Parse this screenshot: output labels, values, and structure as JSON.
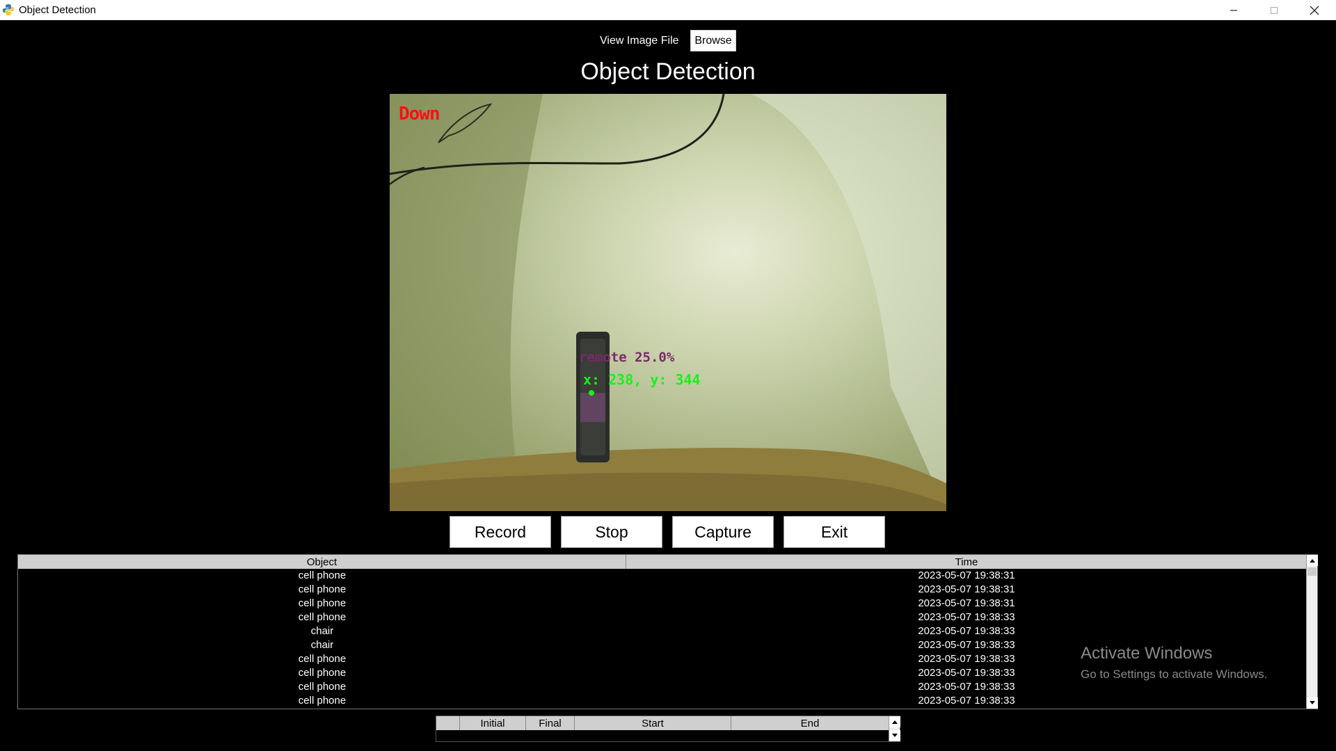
{
  "window": {
    "title": "Object Detection",
    "controls": [
      "minimize",
      "maximize",
      "close"
    ]
  },
  "file": {
    "label": "View Image File",
    "browse_label": "Browse"
  },
  "page_title": "Object Detection",
  "feed": {
    "status_text": "Down",
    "detection_label": "remote 25.0%",
    "coords_text": "x: 238, y: 344"
  },
  "controls": {
    "record": "Record",
    "stop": "Stop",
    "capture": "Capture",
    "exit": "Exit"
  },
  "log_table": {
    "headers": [
      "Object",
      "Time"
    ],
    "rows": [
      [
        "cell phone",
        "2023-05-07 19:38:31"
      ],
      [
        "cell phone",
        "2023-05-07 19:38:31"
      ],
      [
        "cell phone",
        "2023-05-07 19:38:31"
      ],
      [
        "cell phone",
        "2023-05-07 19:38:33"
      ],
      [
        "chair",
        "2023-05-07 19:38:33"
      ],
      [
        "chair",
        "2023-05-07 19:38:33"
      ],
      [
        "cell phone",
        "2023-05-07 19:38:33"
      ],
      [
        "cell phone",
        "2023-05-07 19:38:33"
      ],
      [
        "cell phone",
        "2023-05-07 19:38:33"
      ],
      [
        "cell phone",
        "2023-05-07 19:38:33"
      ]
    ]
  },
  "movement_table": {
    "headers": [
      "",
      "Initial",
      "Final",
      "Start",
      "End"
    ]
  },
  "watermark": {
    "line1": "Activate Windows",
    "line2": "Go to Settings to activate Windows."
  },
  "colors": {
    "status_text": "#ff1010",
    "detection_label": "#7a2a6a",
    "coords_text": "#17f21a",
    "header_bg": "#cfcfcf"
  }
}
